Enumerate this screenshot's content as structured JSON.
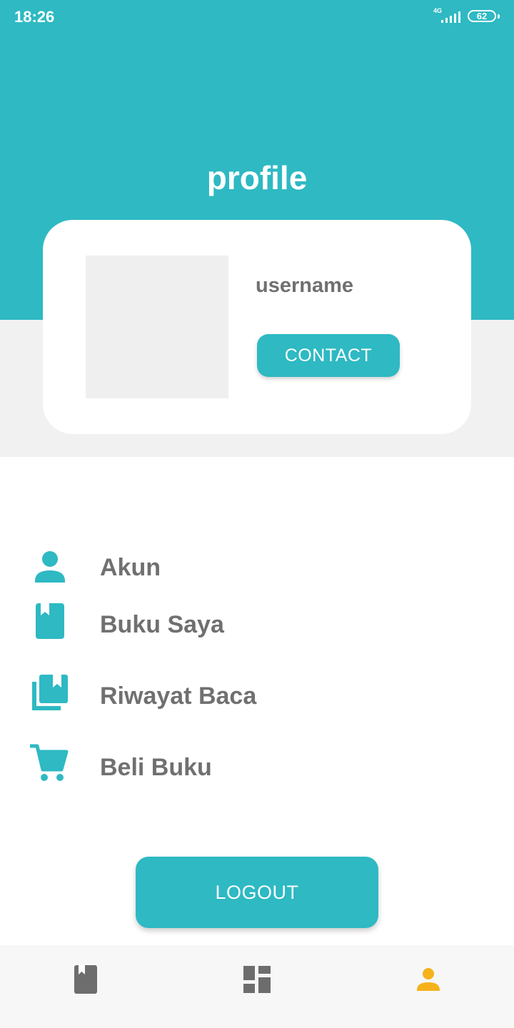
{
  "status_bar": {
    "time": "18:26",
    "network": "4G",
    "battery": "62",
    "icons": [
      "signal-icon",
      "battery-icon"
    ]
  },
  "header": {
    "title": "profile"
  },
  "profile_card": {
    "username": "username",
    "contact_label": "CONTACT"
  },
  "menu": {
    "items": [
      {
        "label": "Akun",
        "icon": "person-icon"
      },
      {
        "label": "Buku Saya",
        "icon": "book-icon"
      },
      {
        "label": "Riwayat Baca",
        "icon": "library-books-icon"
      },
      {
        "label": "Beli Buku",
        "icon": "cart-icon"
      }
    ]
  },
  "logout_label": "LOGOUT",
  "bottom_nav": {
    "tabs": [
      {
        "icon": "book-icon",
        "active": false
      },
      {
        "icon": "dashboard-icon",
        "active": false
      },
      {
        "icon": "person-icon",
        "active": true
      }
    ]
  },
  "colors": {
    "primary": "#2eb9c3",
    "text_gray": "#707070",
    "active_tab": "#f5b21d",
    "inactive_tab": "#6d6d6d"
  }
}
